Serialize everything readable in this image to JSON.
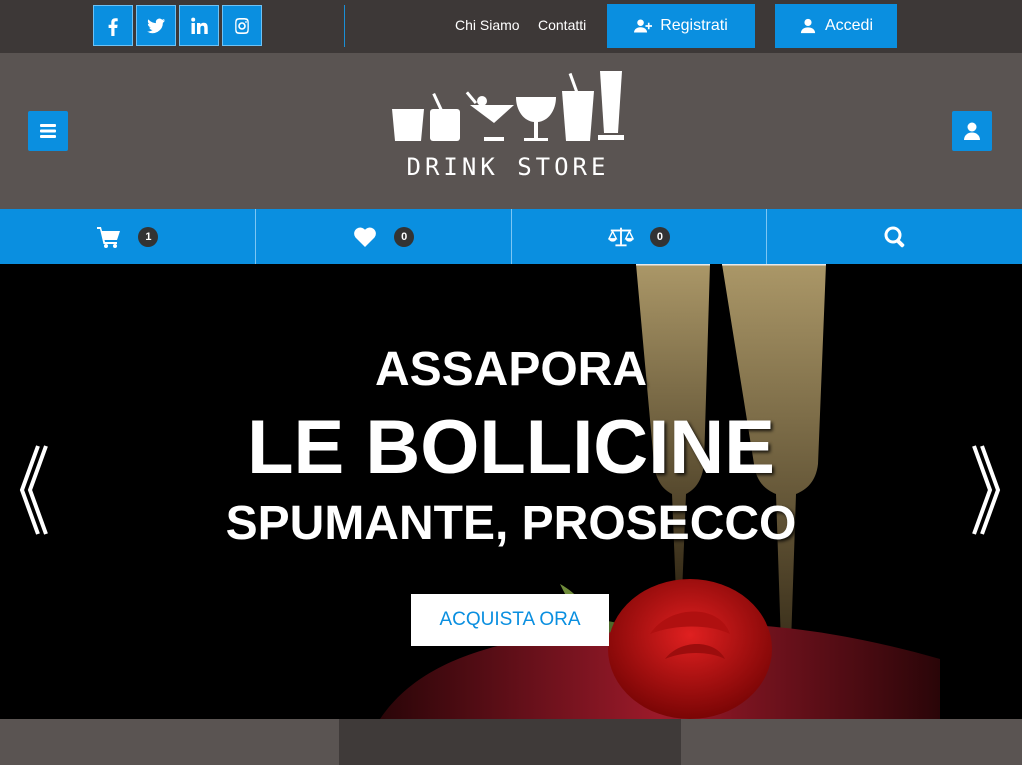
{
  "topbar": {
    "social": [
      "facebook-icon",
      "twitter-icon",
      "linkedin-icon",
      "instagram-icon"
    ],
    "links": {
      "about": "Chi Siamo",
      "contacts": "Contatti"
    },
    "register_label": "Registrati",
    "login_label": "Accedi"
  },
  "header": {
    "logo_text": "DRINK STORE"
  },
  "utility": {
    "cart_count": "1",
    "wishlist_count": "0",
    "compare_count": "0"
  },
  "hero": {
    "line1": "ASSAPORA",
    "line2": "LE BOLLICINE",
    "line3": "SPUMANTE, PROSECCO",
    "cta_label": "ACQUISTA ORA"
  },
  "colors": {
    "accent": "#0a8fe0",
    "topbar_bg": "#3d3837",
    "header_bg": "#5a5452"
  }
}
